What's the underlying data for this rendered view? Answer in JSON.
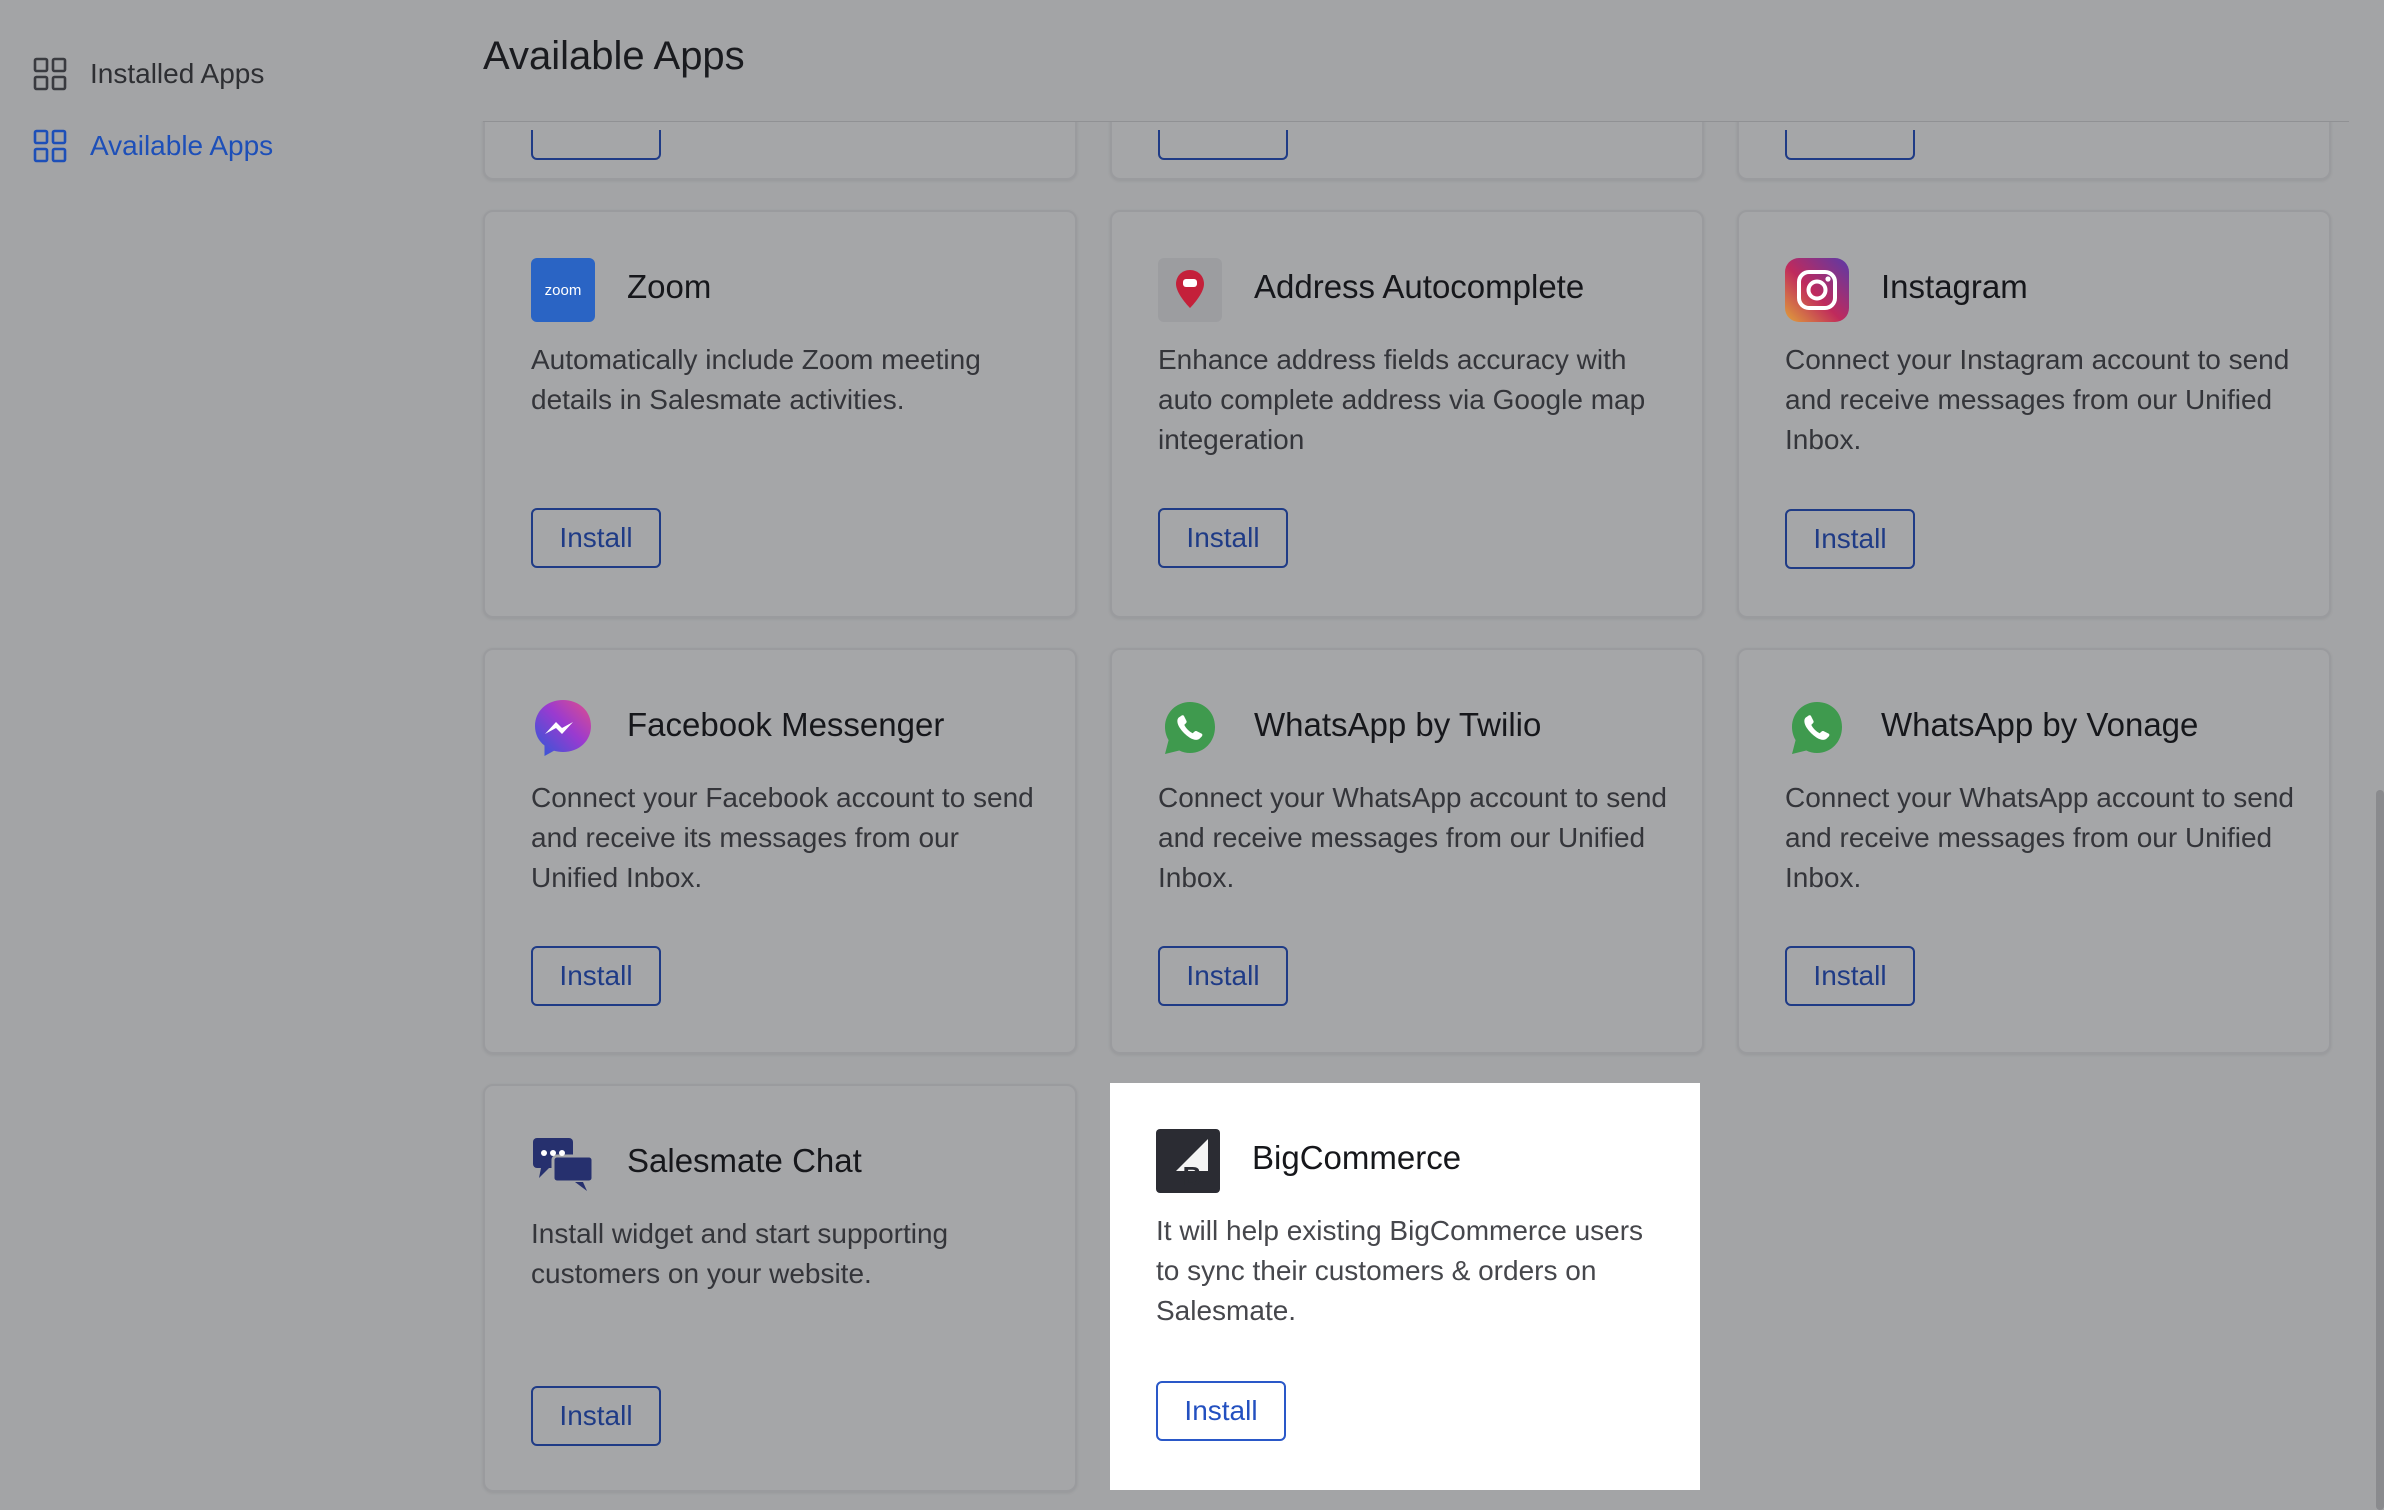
{
  "sidebar": {
    "items": [
      {
        "label": "Installed Apps",
        "icon": "grid-icon",
        "active": false
      },
      {
        "label": "Available Apps",
        "icon": "grid-icon",
        "active": true
      }
    ]
  },
  "main": {
    "title": "Available Apps",
    "apps": [
      {
        "name": "Zoom",
        "icon": "zoom-logo-icon",
        "description": "Automatically include Zoom meeting details in Salesmate activities.",
        "button": "Install"
      },
      {
        "name": "Address Autocomplete",
        "icon": "map-pin-icon",
        "description": "Enhance address fields accuracy with auto complete address via Google map integeration",
        "button": "Install"
      },
      {
        "name": "Instagram",
        "icon": "instagram-logo-icon",
        "description": "Connect your Instagram account to send and receive messages from our Unified Inbox.",
        "button": "Install"
      },
      {
        "name": "Facebook Messenger",
        "icon": "messenger-logo-icon",
        "description": "Connect your Facebook account to send and receive its messages from our Unified Inbox.",
        "button": "Install"
      },
      {
        "name": "WhatsApp by Twilio",
        "icon": "whatsapp-logo-icon",
        "description": "Connect your WhatsApp account to send and receive messages from our Unified Inbox.",
        "button": "Install"
      },
      {
        "name": "WhatsApp by Vonage",
        "icon": "whatsapp-logo-icon",
        "description": "Connect your WhatsApp account to send and receive messages from our Unified Inbox.",
        "button": "Install"
      },
      {
        "name": "Salesmate Chat",
        "icon": "chat-bubbles-icon",
        "description": "Install widget and start supporting customers on your website.",
        "button": "Install"
      },
      {
        "name": "BigCommerce",
        "icon": "bigcommerce-logo-icon",
        "description": "It will help existing BigCommerce users to sync their customers & orders on Salesmate.",
        "button": "Install",
        "highlighted": true
      }
    ]
  },
  "colors": {
    "accent": "#1d4fb8",
    "button_border": "#1f3b86",
    "overlay_background": "#a3a4a6",
    "card_highlight": "#ffffff"
  }
}
